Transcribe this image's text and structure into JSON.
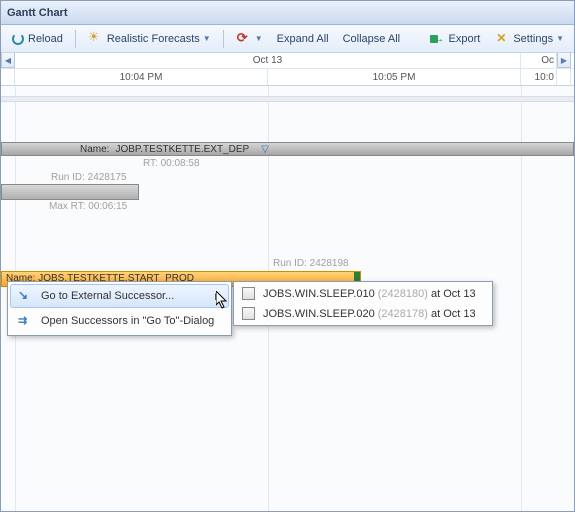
{
  "window": {
    "title": "Gantt Chart"
  },
  "toolbar": {
    "reload": "Reload",
    "forecasts": "Realistic Forecasts",
    "expand_all": "Expand All",
    "collapse_all": "Collapse All",
    "export": "Export",
    "settings": "Settings"
  },
  "timeline": {
    "date1": "Oct 13",
    "date2": "Oc",
    "time1": "10:04 PM",
    "time2": "10:05 PM",
    "time3": "10:0"
  },
  "bars": {
    "job_name_label": "Name:",
    "job_name": "JOBP.TESTKETTE.EXT_DEP",
    "rt_label": "RT: 00:08:58",
    "run_id1": "Run ID: 2428175",
    "max_rt": "Max RT: 00:06:15",
    "run_id2": "Run ID: 2428198",
    "job2_label": "Name: JOBS.TESTKETTE.START_PROD"
  },
  "context_menu": {
    "goto": "Go to External Successor...",
    "open": "Open Successors in \"Go To\"-Dialog"
  },
  "submenu": {
    "items": [
      {
        "name": "JOBS.WIN.SLEEP.010",
        "id": "(2428180)",
        "at": "at Oct 13"
      },
      {
        "name": "JOBS.WIN.SLEEP.020",
        "id": "(2428178)",
        "at": "at Oct 13"
      }
    ]
  }
}
